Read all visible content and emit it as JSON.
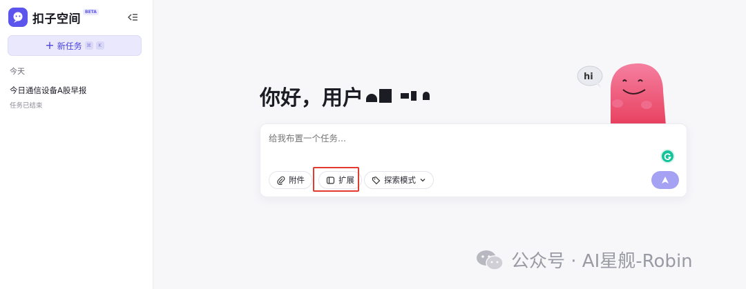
{
  "sidebar": {
    "brand_name": "扣子空间",
    "beta_badge": "BETA",
    "new_task_label": "新任务",
    "shortcut_keys": [
      "⌘",
      "K"
    ],
    "section_today": "今天",
    "tasks": [
      {
        "title": "今日通信设备A股早报",
        "status": "任务已结束"
      }
    ]
  },
  "main": {
    "greeting": "你好，用户",
    "mascot_speech": "hi",
    "input_placeholder": "给我布置一个任务...",
    "buttons": {
      "attach": "附件",
      "extension": "扩展",
      "mode": "探索模式"
    }
  },
  "watermark": {
    "text": "公众号 · AI星舰-Robin"
  },
  "colors": {
    "accent": "#5b55ee",
    "send_button": "#a6a2f3",
    "highlight_box": "#e23b2e",
    "grammarly": "#15c39a"
  }
}
